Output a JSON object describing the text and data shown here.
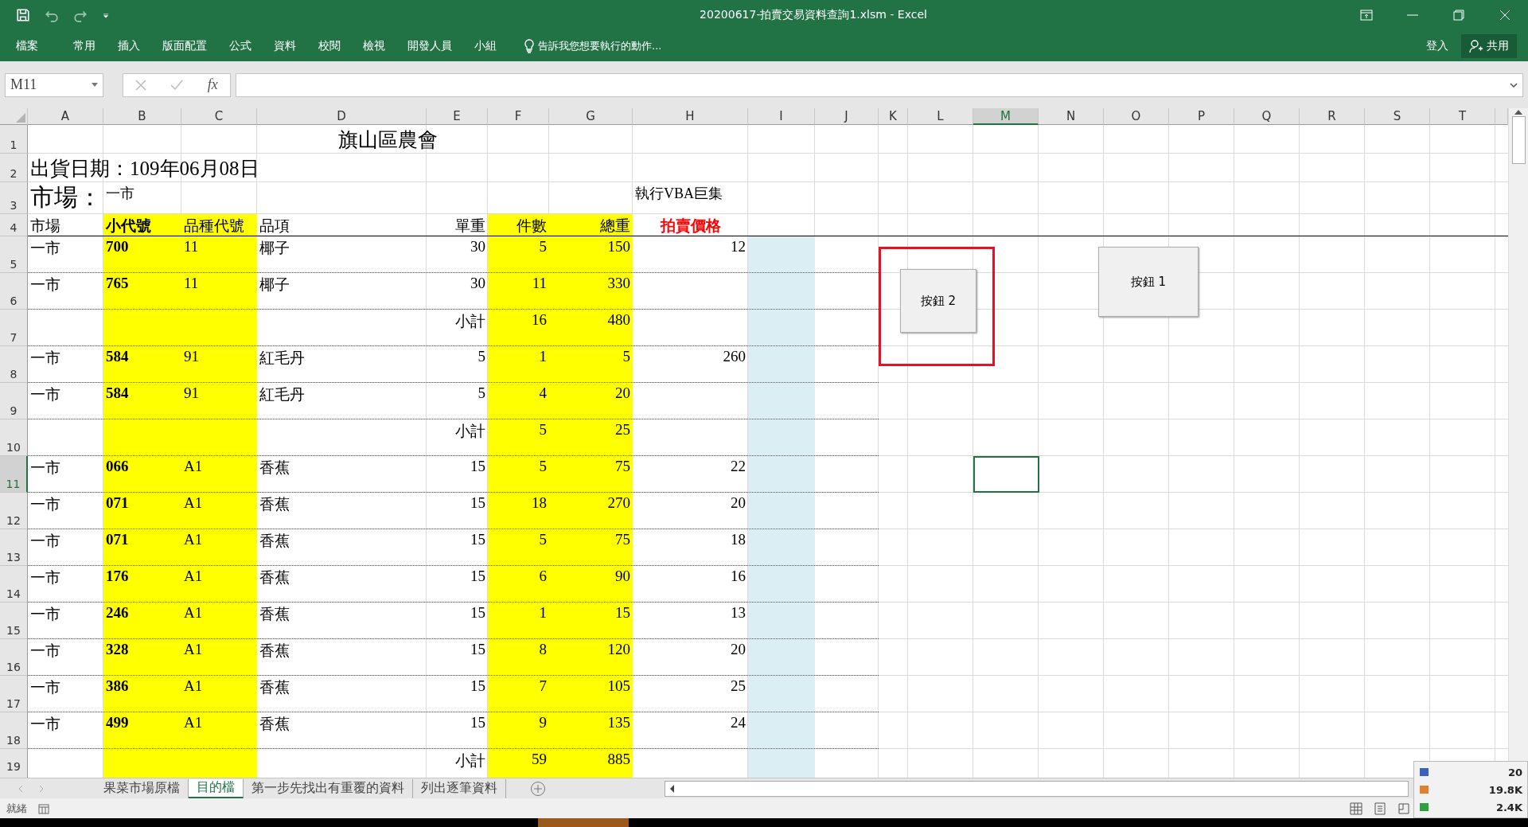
{
  "window": {
    "title": "20200617-拍賣交易資料查詢1.xlsm - Excel"
  },
  "ribbon_tabs": [
    "檔案",
    "常用",
    "插入",
    "版面配置",
    "公式",
    "資料",
    "校閱",
    "檢視",
    "開發人員",
    "小組"
  ],
  "tell_me": "告訴我您想要執行的動作...",
  "sign_in": "登入",
  "share": "共用",
  "name_box": "M11",
  "fx": "fx",
  "columns": [
    {
      "label": "A",
      "selected": false
    },
    {
      "label": "B",
      "selected": false
    },
    {
      "label": "C",
      "selected": false
    },
    {
      "label": "D",
      "selected": false
    },
    {
      "label": "E",
      "selected": false
    },
    {
      "label": "F",
      "selected": false
    },
    {
      "label": "G",
      "selected": false
    },
    {
      "label": "H",
      "selected": false
    },
    {
      "label": "I",
      "selected": false
    },
    {
      "label": "J",
      "selected": false
    },
    {
      "label": "K",
      "selected": false
    },
    {
      "label": "L",
      "selected": false
    },
    {
      "label": "M",
      "selected": true
    },
    {
      "label": "N",
      "selected": false
    },
    {
      "label": "O",
      "selected": false
    },
    {
      "label": "P",
      "selected": false
    },
    {
      "label": "Q",
      "selected": false
    },
    {
      "label": "R",
      "selected": false
    },
    {
      "label": "S",
      "selected": false
    },
    {
      "label": "T",
      "selected": false
    }
  ],
  "row_headers": [
    {
      "label": "1",
      "selected": false
    },
    {
      "label": "2",
      "selected": false
    },
    {
      "label": "3",
      "selected": false
    },
    {
      "label": "4",
      "selected": false
    },
    {
      "label": "5",
      "selected": false
    },
    {
      "label": "6",
      "selected": false
    },
    {
      "label": "7",
      "selected": false
    },
    {
      "label": "8",
      "selected": false
    },
    {
      "label": "9",
      "selected": false
    },
    {
      "label": "10",
      "selected": false
    },
    {
      "label": "11",
      "selected": true
    },
    {
      "label": "12",
      "selected": false
    },
    {
      "label": "13",
      "selected": false
    },
    {
      "label": "14",
      "selected": false
    },
    {
      "label": "15",
      "selected": false
    },
    {
      "label": "16",
      "selected": false
    },
    {
      "label": "17",
      "selected": false
    },
    {
      "label": "18",
      "selected": false
    },
    {
      "label": "19",
      "selected": false
    }
  ],
  "sheet": {
    "title": "旗山區農會",
    "ship_date": "出貨日期：109年06月08日",
    "market_label": "市場：",
    "market_value": "一市",
    "macro_note": "執行VBA巨集",
    "headers": [
      {
        "label": "市場",
        "bold": false
      },
      {
        "label": "小代號",
        "bold": true
      },
      {
        "label": "品種代號",
        "bold": false
      },
      {
        "label": "品項",
        "bold": false
      },
      {
        "label": "單重",
        "bold": false
      },
      {
        "label": "件數",
        "bold": false
      },
      {
        "label": "總重",
        "bold": false
      },
      {
        "label": "拍賣價格",
        "bold": true,
        "color": "#ff0000"
      }
    ],
    "records": [
      {
        "kind": "item",
        "market": "一市",
        "small_code": "700",
        "variety_code": "11",
        "item": "椰子",
        "unit_weight": "30",
        "count": "5",
        "total_weight": "150",
        "price": "12"
      },
      {
        "kind": "item",
        "market": "一市",
        "small_code": "765",
        "variety_code": "11",
        "item": "椰子",
        "unit_weight": "30",
        "count": "11",
        "total_weight": "330"
      },
      {
        "kind": "subtotal",
        "label": "小計",
        "count": "16",
        "total_weight": "480"
      },
      {
        "kind": "item",
        "market": "一市",
        "small_code": "584",
        "variety_code": "91",
        "item": "紅毛丹",
        "unit_weight": "5",
        "count": "1",
        "total_weight": "5",
        "price": "260"
      },
      {
        "kind": "item",
        "market": "一市",
        "small_code": "584",
        "variety_code": "91",
        "item": "紅毛丹",
        "unit_weight": "5",
        "count": "4",
        "total_weight": "20"
      },
      {
        "kind": "subtotal",
        "label": "小計",
        "count": "5",
        "total_weight": "25"
      },
      {
        "kind": "item",
        "market": "一市",
        "small_code": "066",
        "variety_code": "A1",
        "item": "香蕉",
        "unit_weight": "15",
        "count": "5",
        "total_weight": "75",
        "price": "22"
      },
      {
        "kind": "item",
        "market": "一市",
        "small_code": "071",
        "variety_code": "A1",
        "item": "香蕉",
        "unit_weight": "15",
        "count": "18",
        "total_weight": "270",
        "price": "20"
      },
      {
        "kind": "item",
        "market": "一市",
        "small_code": "071",
        "variety_code": "A1",
        "item": "香蕉",
        "unit_weight": "15",
        "count": "5",
        "total_weight": "75",
        "price": "18"
      },
      {
        "kind": "item",
        "market": "一市",
        "small_code": "176",
        "variety_code": "A1",
        "item": "香蕉",
        "unit_weight": "15",
        "count": "6",
        "total_weight": "90",
        "price": "16"
      },
      {
        "kind": "item",
        "market": "一市",
        "small_code": "246",
        "variety_code": "A1",
        "item": "香蕉",
        "unit_weight": "15",
        "count": "1",
        "total_weight": "15",
        "price": "13"
      },
      {
        "kind": "item",
        "market": "一市",
        "small_code": "328",
        "variety_code": "A1",
        "item": "香蕉",
        "unit_weight": "15",
        "count": "8",
        "total_weight": "120",
        "price": "20"
      },
      {
        "kind": "item",
        "market": "一市",
        "small_code": "386",
        "variety_code": "A1",
        "item": "香蕉",
        "unit_weight": "15",
        "count": "7",
        "total_weight": "105",
        "price": "25"
      },
      {
        "kind": "item",
        "market": "一市",
        "small_code": "499",
        "variety_code": "A1",
        "item": "香蕉",
        "unit_weight": "15",
        "count": "9",
        "total_weight": "135",
        "price": "24"
      },
      {
        "kind": "subtotal",
        "label": "小計",
        "count": "59",
        "total_weight": "885"
      }
    ]
  },
  "form_buttons": [
    {
      "label": "按鈕 2",
      "highlighted": true
    },
    {
      "label": "按鈕 1",
      "highlighted": false
    }
  ],
  "sheet_tabs": [
    {
      "label": "果菜市場原檔",
      "selected": false
    },
    {
      "label": "目的檔",
      "selected": true
    },
    {
      "label": "第一步先找出有重覆的資料",
      "selected": false
    },
    {
      "label": "列出逐筆資料",
      "selected": false
    }
  ],
  "status": "就緒",
  "monitor": [
    "20",
    "19.8K",
    "2.4K"
  ]
}
